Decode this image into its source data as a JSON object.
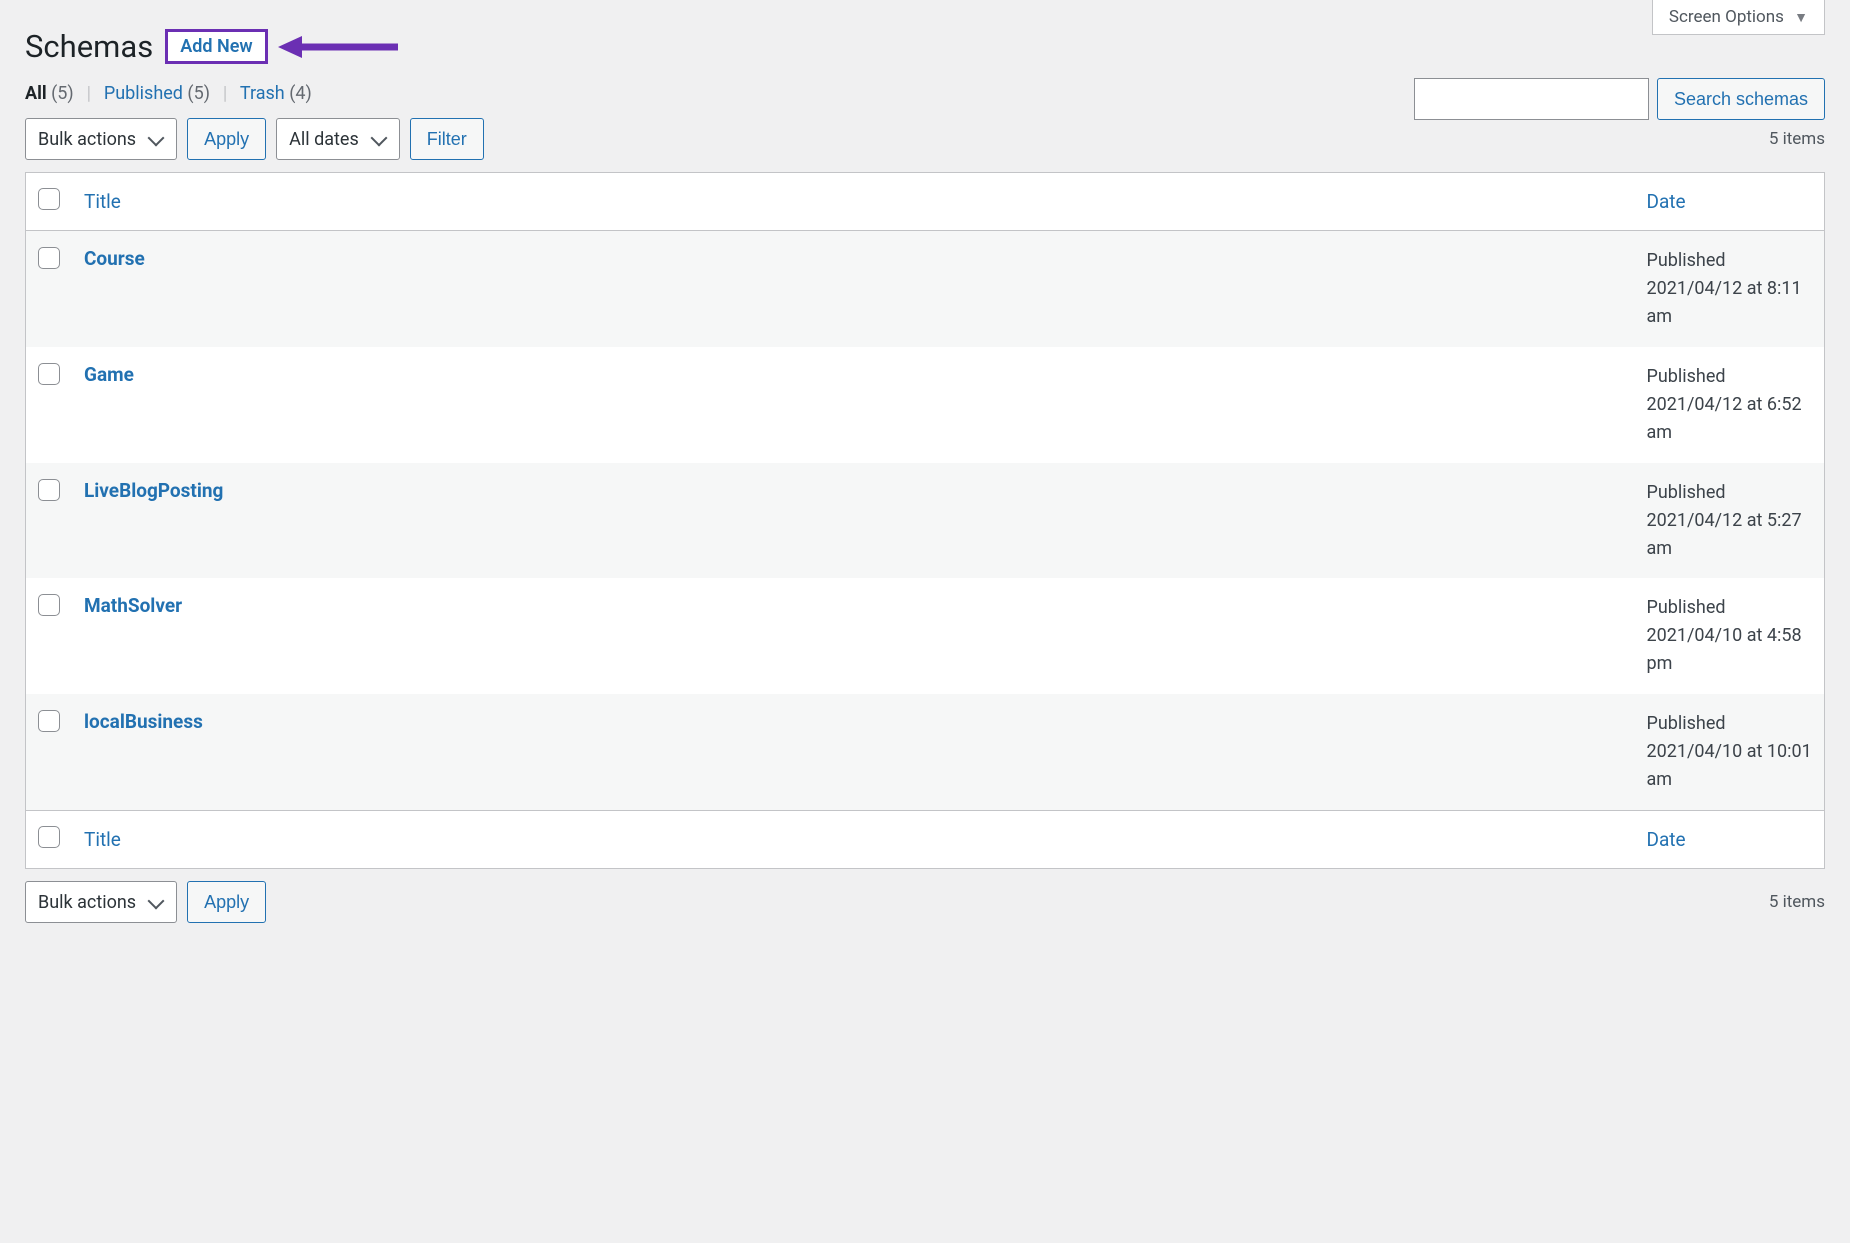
{
  "screenOptions": {
    "label": "Screen Options"
  },
  "page": {
    "title": "Schemas",
    "addNew": "Add New"
  },
  "views": {
    "allLabel": "All",
    "allCount": "(5)",
    "publishedLabel": "Published",
    "publishedCount": "(5)",
    "trashLabel": "Trash",
    "trashCount": "(4)"
  },
  "search": {
    "button": "Search schemas"
  },
  "filters": {
    "bulkActions": "Bulk actions",
    "apply": "Apply",
    "allDates": "All dates",
    "filter": "Filter",
    "itemsCount": "5 items"
  },
  "columns": {
    "title": "Title",
    "date": "Date"
  },
  "rows": [
    {
      "title": "Course",
      "status": "Published",
      "dateLine": "2021/04/12 at 8:11 am"
    },
    {
      "title": "Game",
      "status": "Published",
      "dateLine": "2021/04/12 at 6:52 am"
    },
    {
      "title": "LiveBlogPosting",
      "status": "Published",
      "dateLine": "2021/04/12 at 5:27 am"
    },
    {
      "title": "MathSolver",
      "status": "Published",
      "dateLine": "2021/04/10 at 4:58 pm"
    },
    {
      "title": "localBusiness",
      "status": "Published",
      "dateLine": "2021/04/10 at 10:01 am"
    }
  ]
}
